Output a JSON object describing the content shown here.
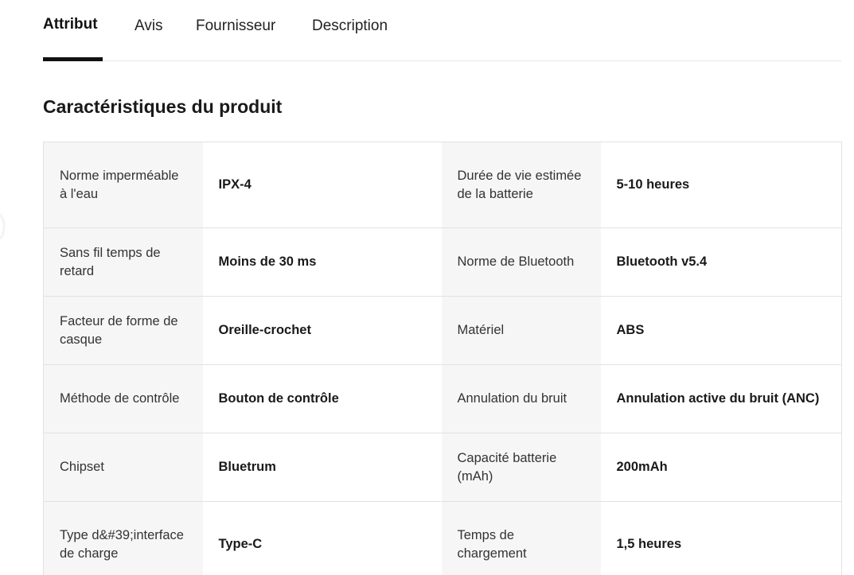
{
  "tabs": [
    {
      "label": "Attribut",
      "active": true
    },
    {
      "label": "Avis",
      "active": false
    },
    {
      "label": "Fournisseur",
      "active": false
    },
    {
      "label": "Description",
      "active": false
    }
  ],
  "section_title": "Caractéristiques du produit",
  "rows": [
    {
      "label1": "Norme imperméable à l'eau",
      "value1": "IPX-4",
      "label2": "Durée de vie estimée de la batterie",
      "value2": "5-10 heures"
    },
    {
      "label1": "Sans fil temps de retard",
      "value1": "Moins de 30 ms",
      "label2": "Norme de Bluetooth",
      "value2": "Bluetooth v5.4"
    },
    {
      "label1": "Facteur de forme de casque",
      "value1": "Oreille-crochet",
      "label2": "Matériel",
      "value2": "ABS"
    },
    {
      "label1": "Méthode de contrôle",
      "value1": "Bouton de contrôle",
      "label2": "Annulation du bruit",
      "value2": "Annulation active du bruit (ANC)"
    },
    {
      "label1": "Chipset",
      "value1": "Bluetrum",
      "label2": "Capacité batterie (mAh)",
      "value2": "200mAh"
    },
    {
      "label1": "Type d&#39;interface de charge",
      "value1": "Type-C",
      "label2": "Temps de chargement",
      "value2": "1,5 heures"
    }
  ]
}
